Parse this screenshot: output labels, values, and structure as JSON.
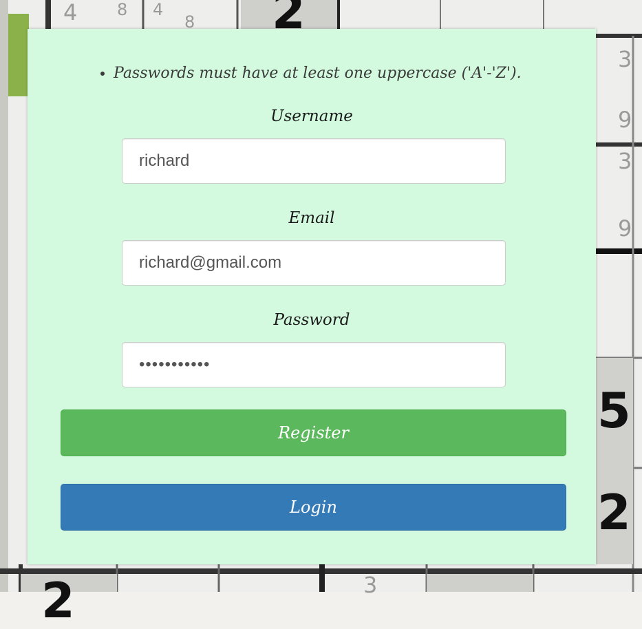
{
  "rules": [
    "Passwords must have at least one uppercase ('A'-'Z')."
  ],
  "form": {
    "username_label": "Username",
    "username_value": "richard",
    "email_label": "Email",
    "email_value": "richard@gmail.com",
    "password_label": "Password",
    "password_value": "richard1234",
    "register_label": "Register",
    "login_label": "Login"
  },
  "background": {
    "numbers": [
      "4",
      "8",
      "4",
      "8",
      "2",
      "3",
      "9",
      "3",
      "9",
      "5",
      "2",
      "2",
      "3"
    ]
  },
  "colors": {
    "card": "#d3fadf",
    "register": "#5cb85c",
    "login": "#337ab7"
  }
}
